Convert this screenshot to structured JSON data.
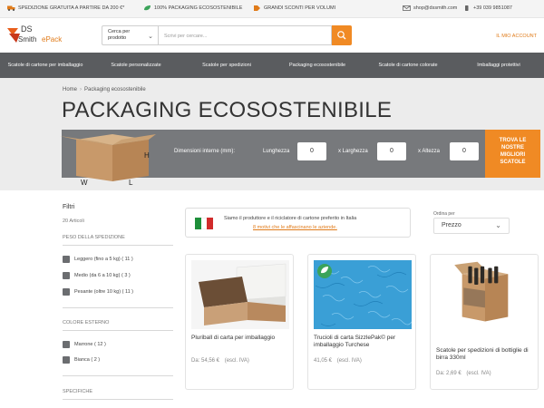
{
  "topbar": {
    "shipping": "SPEDIZIONE GRATUITA A PARTIRE DA 200 €*",
    "eco": "100% PACKAGING ECOSOSTENIBILE",
    "discount": "GRANDI SCONTI PER VOLUMI",
    "email": "shop@dssmith.com",
    "phone": "+39 039 9851087"
  },
  "header": {
    "logo_line1": "DS",
    "logo_line2": "Smith",
    "logo_line3": "ePack",
    "category_select": "Cerca per prodotto",
    "search_placeholder": "Scrivi per cercare...",
    "account": "IL MIO ACCOUNT"
  },
  "nav": [
    "Scatole di cartone per imballaggio",
    "Scatole personalizzate",
    "Scatole per spedizioni",
    "Packaging ecosostenibile",
    "Scatole di cartone colorate",
    "Imballaggi protettivi"
  ],
  "breadcrumb": {
    "home": "Home",
    "current": "Packaging ecosostenibile"
  },
  "page_title": "PACKAGING ECOSOSTENIBILE",
  "dimensions": {
    "label": "Dimensioni interne (mm):",
    "length_label": "Lunghezza",
    "width_label": "x Larghezza",
    "height_label": "x Altezza",
    "length_value": "0",
    "width_value": "0",
    "height_value": "0",
    "box_h": "H",
    "box_w": "W",
    "box_l": "L",
    "button": "TROVA LE NOSTRE MIGLIORI SCATOLE"
  },
  "filters": {
    "title": "Filtri",
    "count": "20 Articoli",
    "weight_heading": "PESO DELLA SPEDIZIONE",
    "weight_options": [
      "Leggero (fino a 5 kg) ( 11 )",
      "Medio (da 6 a 10 kg) ( 3 )",
      "Pesante (oltre 10 kg) ( 11 )"
    ],
    "color_heading": "COLORE ESTERNO",
    "color_options": [
      "Marrone ( 12 )",
      "Bianca ( 2 )"
    ],
    "specs_heading": "SPECIFICHE"
  },
  "banner": {
    "text": "Siamo il produttore e il riciclatore di cartone preferito in Italia",
    "link": "8 motivi che le affascinano le aziende."
  },
  "sort": {
    "label": "Ordina per",
    "value": "Prezzo"
  },
  "products": [
    {
      "name": "Pluriball di carta per imballaggio",
      "price": "Da: 54,56 €",
      "tax": "(escl. IVA)"
    },
    {
      "name": "Trucioli di carta SizzlePak© per imballaggio Turchese",
      "price": "41,05 €",
      "tax": "(escl. IVA)"
    },
    {
      "name": "Scatole per spedizioni di bottiglie di birra 330ml",
      "price": "Da: 2,69 €",
      "tax": "(escl. IVA)"
    }
  ],
  "colors": {
    "accent": "#f08a24",
    "nav": "#5a5c5f",
    "dimbar": "#77797c",
    "turquoise": "#3a9fd6"
  }
}
